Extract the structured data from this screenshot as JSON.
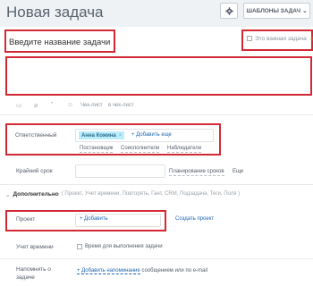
{
  "header": {
    "title": "Новая задача",
    "settings_icon": "gear-icon",
    "templates_label": "ШАБЛОНЫ ЗАДАЧ"
  },
  "form": {
    "title_placeholder": "Введите название задачи",
    "important_label": "Это важная задача",
    "toolbar": {
      "checklist_label": "Чек-лист",
      "in_checklist_label": "в чек-лист"
    },
    "responsible": {
      "label": "Ответственный",
      "user": "Анна Кожина",
      "add_more": "+ Добавить еще",
      "roles": [
        "Постановщик",
        "Соисполнители",
        "Наблюдатели"
      ]
    },
    "deadline": {
      "label": "Крайний срок",
      "plan_link": "Планирование сроков",
      "more_link": "Еще"
    },
    "extra": {
      "label": "Дополнительно",
      "list": "( Проект, Учет времени, Повторять, Гант, CRM, Подзадача, Теги, Поля )"
    },
    "project": {
      "label": "Проект",
      "add": "+ Добавить",
      "create": "Создать проект"
    },
    "time_tracking": {
      "label": "Учет времени",
      "checkbox_label": "Время для выполнения задачи"
    },
    "reminder": {
      "label": "Напомнить о задаче",
      "link": "+ Добавить напоминание",
      "suffix": "сообщением или по e-mail"
    }
  },
  "colors": {
    "highlight": "#d22a34",
    "link": "#2067b0",
    "user_tag": "#bcedfc"
  }
}
